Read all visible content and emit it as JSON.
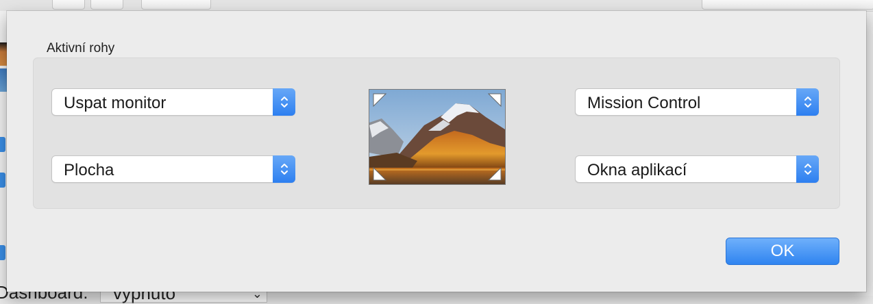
{
  "background": {
    "bottom_label": "Dashboard:",
    "bottom_popup_value": "vypnuto"
  },
  "dialog": {
    "section_title": "Aktivní rohy",
    "corners": {
      "top_left": "Uspat monitor",
      "bottom_left": "Plocha",
      "top_right": "Mission Control",
      "bottom_right": "Okna aplikací"
    },
    "ok_label": "OK"
  },
  "colors": {
    "accent": "#2f84f0",
    "sheet_bg": "#ececec",
    "group_bg": "#e2e2e2"
  }
}
